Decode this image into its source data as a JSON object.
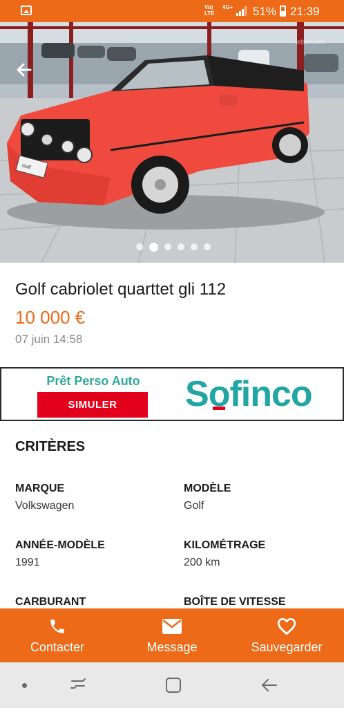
{
  "status_bar": {
    "volte": "Vo)\nLTE",
    "network": "4G+",
    "battery": "51%",
    "time": "21:39"
  },
  "gallery": {
    "watermark": "leboncoin",
    "photo_count": 6,
    "active_index": 1,
    "photo_plate_text": "Golf"
  },
  "listing": {
    "title": "Golf cabriolet quarttet gli 112",
    "price": "10 000 €",
    "date": "07 juin 14:58"
  },
  "ad": {
    "headline": "Prêt Perso Auto",
    "cta": "SIMULER",
    "brand": "Sofinco",
    "brand_pre": "S",
    "brand_o": "o",
    "brand_post": "finco"
  },
  "criteria": {
    "title": "CRITÈRES",
    "items": [
      {
        "label": "MARQUE",
        "value": "Volkswagen"
      },
      {
        "label": "MODÈLE",
        "value": "Golf"
      },
      {
        "label": "ANNÉE-MODÈLE",
        "value": "1991"
      },
      {
        "label": "KILOMÉTRAGE",
        "value": "200 km"
      },
      {
        "label": "CARBURANT",
        "value": ""
      },
      {
        "label": "BOÎTE DE VITESSE",
        "value": ""
      }
    ]
  },
  "actions": {
    "contact": "Contacter",
    "message": "Message",
    "save": "Sauvegarder"
  },
  "colors": {
    "accent": "#ec6a18",
    "ad_red": "#e3001b",
    "ad_teal": "#22a5a5"
  },
  "icons": {
    "back": "arrow-left-icon",
    "contact": "phone-icon",
    "message": "envelope-icon",
    "save": "heart-icon",
    "nav_home": "home-icon"
  }
}
